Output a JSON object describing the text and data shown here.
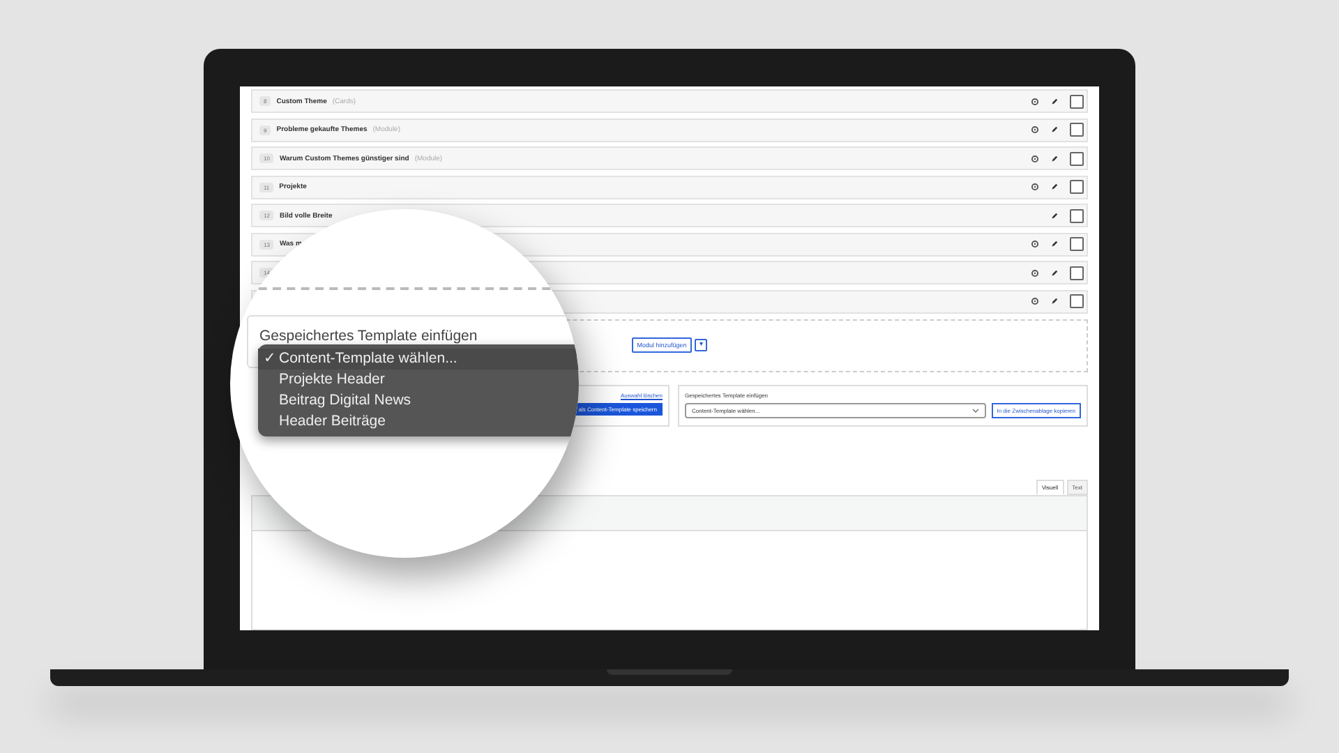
{
  "modules": [
    {
      "number": "8",
      "title": "Custom Theme",
      "type": "(Cards)",
      "gear": true,
      "checked": false
    },
    {
      "number": "9",
      "title": "Probleme gekaufte Themes",
      "type": "(Module)",
      "gear": true,
      "checked": false
    },
    {
      "number": "10",
      "title": "Warum Custom Themes günstiger sind",
      "type": "(Module)",
      "gear": true,
      "checked": false
    },
    {
      "number": "11",
      "title": "Projekte",
      "gear": true,
      "checked": false
    },
    {
      "number": "12",
      "title": "Bild volle Breite",
      "gear": false,
      "checked": false
    },
    {
      "number": "13",
      "title": "Was m",
      "gear": true,
      "checked": false
    },
    {
      "number": "14",
      "gear": true,
      "checked": false
    },
    {
      "gear": true,
      "checked": false
    }
  ],
  "add_module": {
    "label": "Modul hinzufügen",
    "caret": "▾"
  },
  "save_panel": {
    "link": "Auswahl löschen",
    "button": "als Content-Template speichern"
  },
  "insert_panel": {
    "title": "Gespeichertes Template einfügen",
    "select": "Content-Template wählen...",
    "button": "In die Zwischenablage kopieren"
  },
  "editor": {
    "tabs": [
      {
        "label": "Visuell",
        "selected": true
      },
      {
        "label": "Text",
        "selected": false
      }
    ]
  },
  "magnifier": {
    "heading": "Gespeichertes Template einfügen",
    "options": [
      {
        "label": "Content-Template wählen...",
        "selected": true
      },
      {
        "label": "Projekte Header",
        "selected": false
      },
      {
        "label": "Beitrag Digital News",
        "selected": false
      },
      {
        "label": "Header Beiträge",
        "selected": false
      }
    ],
    "check": "✓"
  }
}
